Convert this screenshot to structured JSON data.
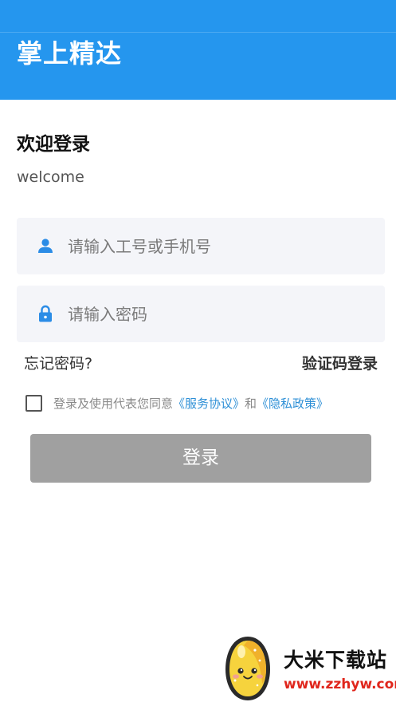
{
  "header": {
    "title": "掌上精达",
    "background_color": "#2596ee"
  },
  "welcome": {
    "heading": "欢迎登录",
    "subtitle": "welcome"
  },
  "form": {
    "username": {
      "icon": "user-icon",
      "placeholder": "请输入工号或手机号",
      "value": ""
    },
    "password": {
      "icon": "lock-icon",
      "placeholder": "请输入密码",
      "value": ""
    },
    "forgot_password": "忘记密码?",
    "code_login": "验证码登录",
    "agreement": {
      "checked": false,
      "prefix": "登录及使用代表您同意",
      "service_link": "《服务协议》",
      "conjunction": "和",
      "privacy_link": "《隐私政策》",
      "link_color": "#2d8fd6"
    },
    "login_button": "登录",
    "login_button_color": "#a0a0a0"
  },
  "watermark": {
    "title": "大米下载站",
    "url": "www.zzhyw.com",
    "icon": "rice-grain-mascot-icon"
  }
}
